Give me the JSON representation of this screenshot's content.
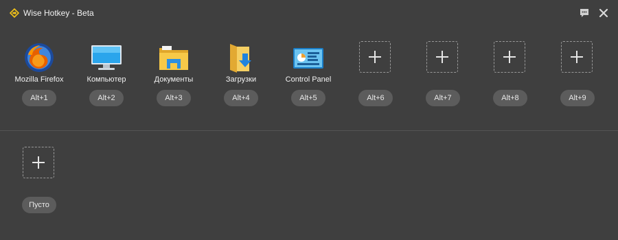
{
  "window": {
    "title": "Wise Hotkey - Beta",
    "icons": {
      "logo": "wise-hotkey-logo-icon",
      "feedback": "speech-bubble-icon",
      "close": "close-icon"
    }
  },
  "slots": [
    {
      "label": "Mozilla Firefox",
      "hotkey": "Alt+1",
      "icon": "firefox-icon"
    },
    {
      "label": "Компьютер",
      "hotkey": "Alt+2",
      "icon": "computer-monitor-icon"
    },
    {
      "label": "Документы",
      "hotkey": "Alt+3",
      "icon": "documents-folder-icon"
    },
    {
      "label": "Загрузки",
      "hotkey": "Alt+4",
      "icon": "downloads-folder-icon"
    },
    {
      "label": "Control Panel",
      "hotkey": "Alt+5",
      "icon": "control-panel-icon"
    },
    {
      "label": "",
      "hotkey": "Alt+6",
      "icon": "add-icon"
    },
    {
      "label": "",
      "hotkey": "Alt+7",
      "icon": "add-icon"
    },
    {
      "label": "",
      "hotkey": "Alt+8",
      "icon": "add-icon"
    },
    {
      "label": "",
      "hotkey": "Alt+9",
      "icon": "add-icon"
    }
  ],
  "custom_slot": {
    "hotkey": "Пусто",
    "icon": "add-icon"
  },
  "colors": {
    "background": "#3f3f3f",
    "badge": "#5c5c5c",
    "accent": "#f5c518"
  }
}
